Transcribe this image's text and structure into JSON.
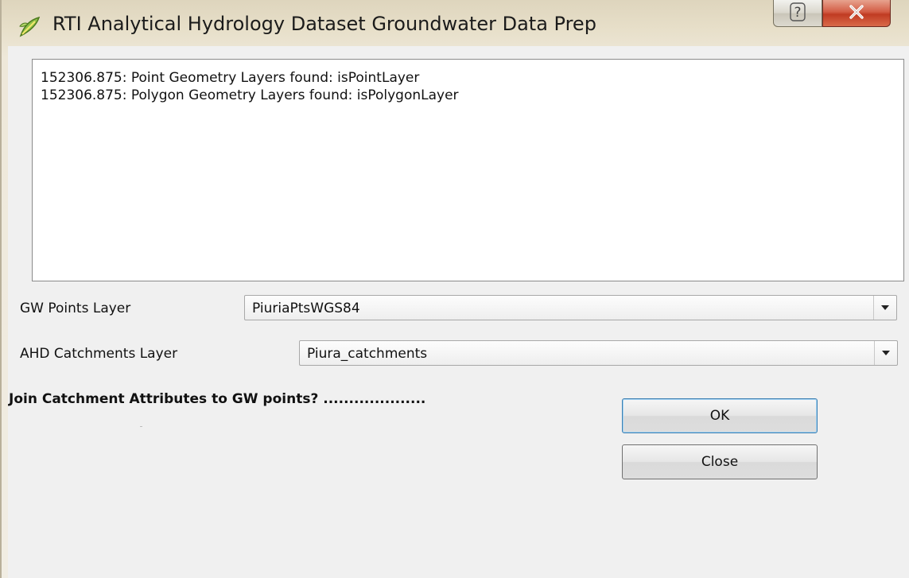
{
  "window": {
    "title": "RTI Analytical Hydrology Dataset Groundwater Data Prep",
    "icon": "qgis-icon",
    "help_glyph": "?",
    "close_glyph": "X"
  },
  "log": {
    "lines": [
      "152306.875: Point Geometry Layers found: isPointLayer",
      "152306.875: Polygon Geometry Layers found: isPolygonLayer"
    ]
  },
  "form": {
    "gw_points": {
      "label": "GW Points Layer",
      "value": "PiuriaPtsWGS84"
    },
    "ahd_catchments": {
      "label": "AHD Catchments Layer",
      "value": "Piura_catchments"
    },
    "join_question": "Join Catchment Attributes to GW points? ...................."
  },
  "buttons": {
    "ok": "OK",
    "close": "Close"
  },
  "colors": {
    "close_button": "#c8432a",
    "default_button_border": "#3c7fb1"
  }
}
